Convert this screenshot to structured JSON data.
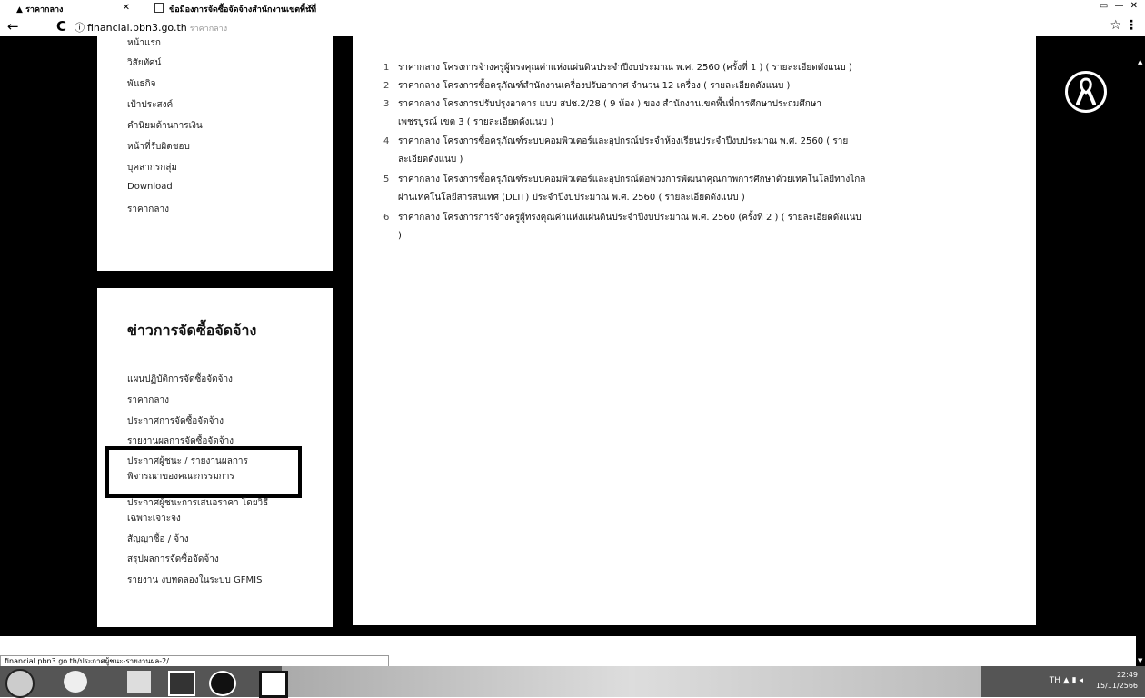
{
  "browser": {
    "tabs": [
      {
        "label": "ราคากลาง"
      },
      {
        "label": "ข้อมืองการจัดซื้อจัดจ้างสำนักงานเขตพื้นที่"
      }
    ],
    "url": "financial.pbn3.go.th",
    "url_suffix": "ราคากลาง"
  },
  "left_nav": {
    "items": [
      "หน้าแรก",
      "วิสัยทัศน์",
      "พันธกิจ",
      "เป้าประสงค์",
      "คำนิยมด้านการเงิน",
      "หน้าที่รับผิดชอบ",
      "บุคลากรกลุ่ม",
      "Download",
      "ราคากลาง"
    ]
  },
  "procurement": {
    "title": "ข่าวการจัดซื้อจัดจ้าง",
    "items": [
      "แผนปฏิบัติการจัดซื้อจัดจ้าง",
      "ราคากลาง",
      "ประกาศการจัดซื้อจัดจ้าง",
      "รายงานผลการจัดซื้อจัดจ้าง",
      "ประกาศผู้ชนะ / รายงานผลการ",
      "พิจารณาของคณะกรรมการ",
      "ประกาศผู้ชนะการเสนอราคา โดยวิธี",
      "เฉพาะเจาะจง",
      "สัญญาซื้อ / จ้าง",
      "สรุปผลการจัดซื้อจัดจ้าง",
      "รายงาน งบทดลองในระบบ GFMIS"
    ]
  },
  "announcements": [
    {
      "num": "1",
      "lines": [
        "ราคากลาง  โครงการจ้างครูผู้ทรงคุณค่าแห่งแผ่นดินประจำปีงบประมาณ พ.ศ. 2560  (ครั้งที่ 1 )  ( รายละเอียดดังแนบ )"
      ]
    },
    {
      "num": "2",
      "lines": [
        "ราคากลาง  โครงการซื้อครุภัณฑ์สำนักงานเครื่องปรับอากาศ จำนวน 12 เครื่อง   ( รายละเอียดดังแนบ )"
      ]
    },
    {
      "num": "3",
      "lines": [
        "ราคากลาง  โครงการปรับปรุงอาคาร  แบบ สปช.2/28 ( 9 ห้อง ) ของ สำนักงานเขตพื้นที่การศึกษาประถมศึกษา",
        "เพชรบูรณ์ เขต 3 ( รายละเอียดดังแนบ )"
      ]
    },
    {
      "num": "4",
      "lines": [
        "ราคากลาง  โครงการซื้อครุภัณฑ์ระบบคอมพิวเตอร์และอุปกรณ์ประจำห้องเรียนประจำปีงบประมาณ พ.ศ. 2560 (  ราย",
        "ละเอียดดังแนบ  )"
      ]
    },
    {
      "num": "5",
      "lines": [
        "ราคากลาง  โครงการซื้อครุภัณฑ์ระบบคอมพิวเตอร์และอุปกรณ์ต่อพ่วงการพัฒนาคุณภาพการศึกษาด้วยเทคโนโลยีทางไกล",
        "ผ่านเทคโนโลยีสารสนเทศ (DLIT) ประจำปีงบประมาณ พ.ศ. 2560 ( รายละเอียดดังแนบ  )"
      ]
    },
    {
      "num": "6",
      "lines": [
        "ราคากลาง  โครงการการจ้างครูผู้ทรงคุณค่าแห่งแผ่นดินประจำปีงบประมาณ พ.ศ. 2560  (ครั้งที่ 2 ) ( รายละเอียดดังแนบ",
        ")"
      ]
    }
  ],
  "statusbar": {
    "text": "financial.pbn3.go.th/ประกาศผู้ชนะ-รายงานผล-2/"
  },
  "taskbar": {
    "lang": "TH",
    "time": "22:49",
    "date": "15/11/2566"
  }
}
